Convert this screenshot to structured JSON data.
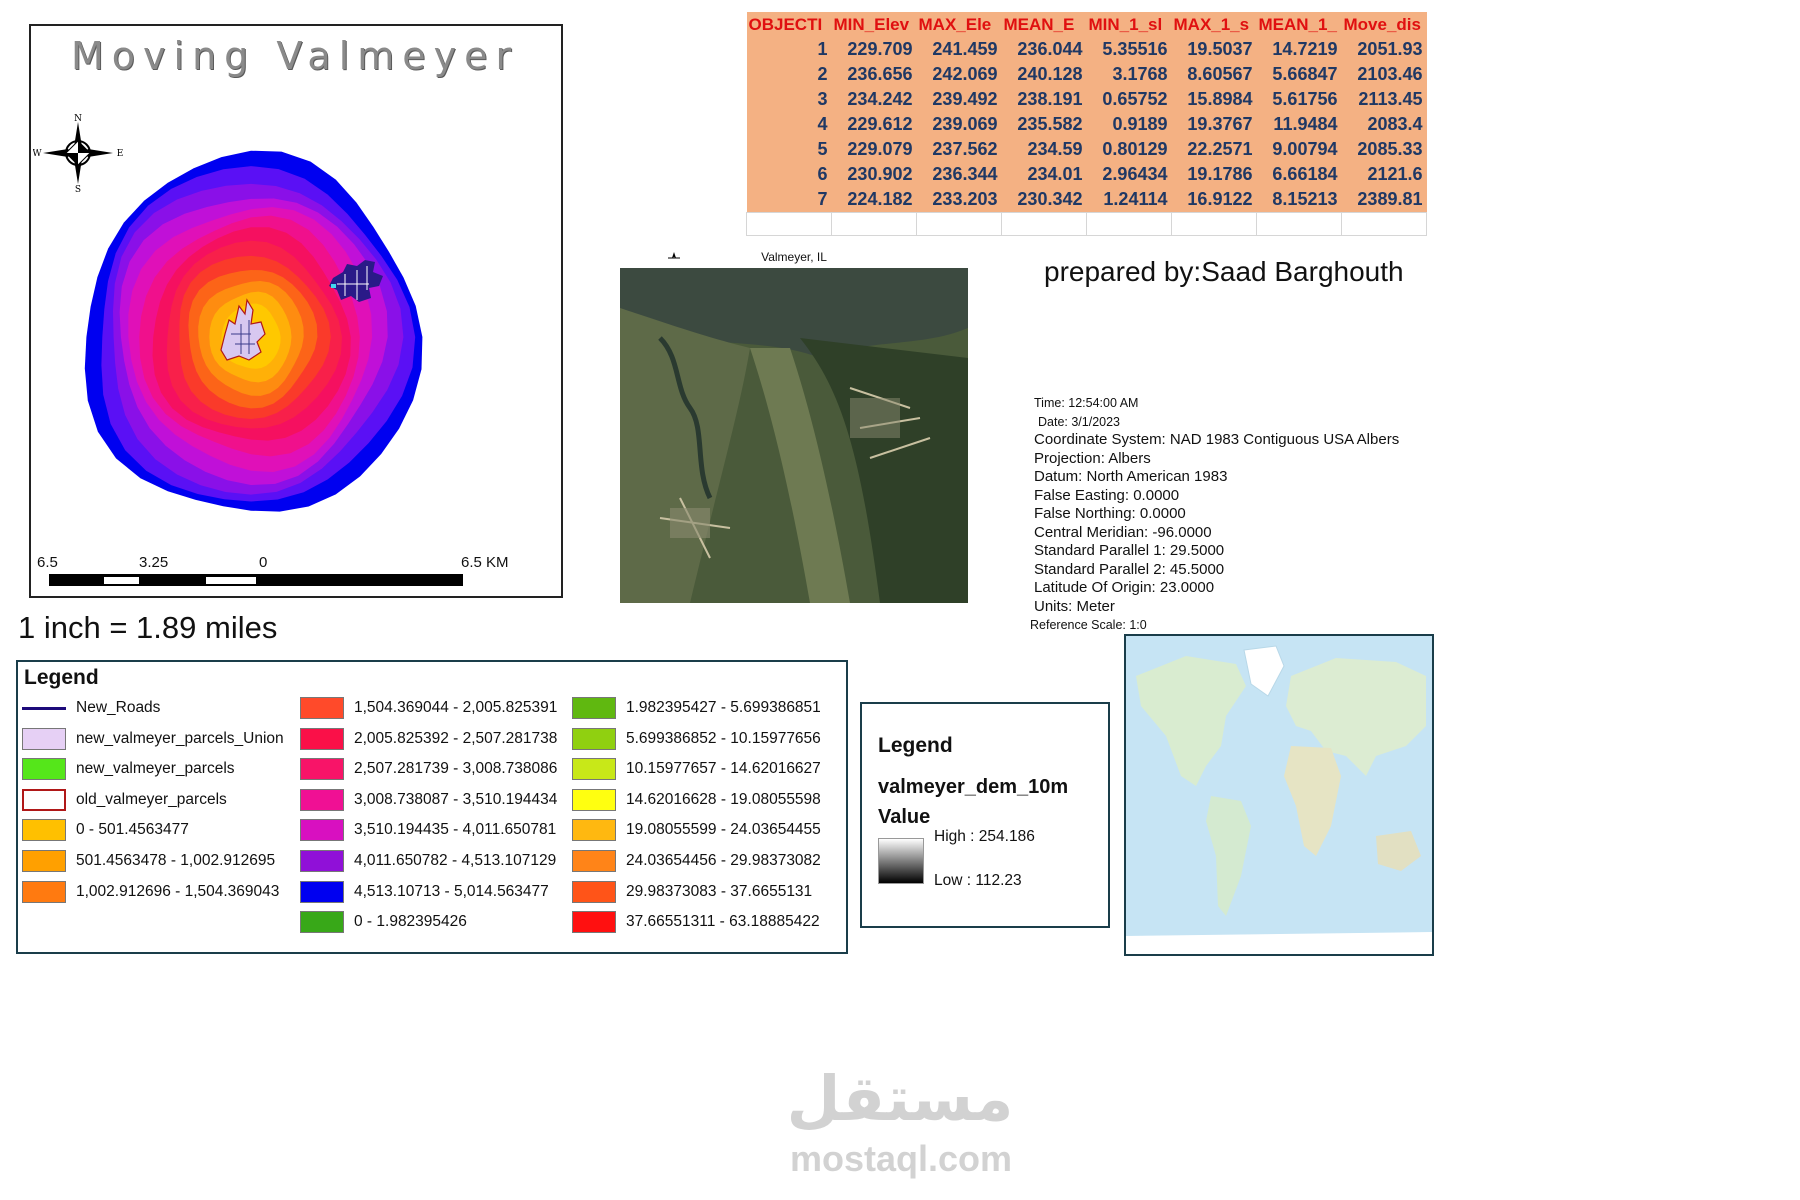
{
  "map": {
    "title": "Moving Valmeyer",
    "north_arrow": {
      "n": "N",
      "e": "E",
      "s": "S",
      "w": "W"
    },
    "scalebar": {
      "labels": [
        "6.5",
        "3.25",
        "0",
        "6.5 KM"
      ]
    },
    "scale_text": "1 inch = 1.89 miles",
    "buffer_ring_colors": [
      "#0000f0",
      "#5a10f5",
      "#8a10e8",
      "#c010d8",
      "#e010b8",
      "#f0108c",
      "#f51060",
      "#f8204a",
      "#fa3a2a",
      "#fc6418",
      "#fe8c10",
      "#ffb008",
      "#ffc800"
    ]
  },
  "attribute_table": {
    "headers": [
      "OBJECTI",
      "MIN_Elev",
      "MAX_Ele",
      "MEAN_E",
      "MIN_1_sl",
      "MAX_1_s",
      "MEAN_1_",
      "Move_dis"
    ],
    "rows": [
      [
        "1",
        "229.709",
        "241.459",
        "236.044",
        "5.35516",
        "19.5037",
        "14.7219",
        "2051.93"
      ],
      [
        "2",
        "236.656",
        "242.069",
        "240.128",
        "3.1768",
        "8.60567",
        "5.66847",
        "2103.46"
      ],
      [
        "3",
        "234.242",
        "239.492",
        "238.191",
        "0.65752",
        "15.8984",
        "5.61756",
        "2113.45"
      ],
      [
        "4",
        "229.612",
        "239.069",
        "235.582",
        "0.9189",
        "19.3767",
        "11.9484",
        "2083.4"
      ],
      [
        "5",
        "229.079",
        "237.562",
        "234.59",
        "0.80129",
        "22.2571",
        "9.00794",
        "2085.33"
      ],
      [
        "6",
        "230.902",
        "236.344",
        "234.01",
        "2.96434",
        "19.1786",
        "6.66184",
        "2121.6"
      ],
      [
        "7",
        "224.182",
        "233.203",
        "230.342",
        "1.24114",
        "16.9122",
        "8.15213",
        "2389.81"
      ]
    ]
  },
  "aerial": {
    "title": "Valmeyer, IL"
  },
  "prepared_by": "prepared by:Saad Barghouth",
  "metadata": {
    "time": "Time: 12:54:00 AM",
    "date": "Date: 3/1/2023",
    "lines": [
      "Coordinate System: NAD 1983 Contiguous USA Albers",
      "Projection: Albers",
      "Datum: North American 1983",
      "False Easting: 0.0000",
      "False Northing: 0.0000",
      "Central Meridian: -96.0000",
      "Standard Parallel 1: 29.5000",
      "Standard Parallel 2: 45.5000",
      "Latitude Of Origin: 23.0000",
      "Units: Meter"
    ],
    "reference_scale": "Reference Scale: 1:0"
  },
  "legend_main": {
    "title": "Legend",
    "col1": [
      {
        "label": "New_Roads",
        "kind": "line",
        "color": "#1d0a7a"
      },
      {
        "label": "new_valmeyer_parcels_Union",
        "kind": "fill",
        "color": "#e6d0f5"
      },
      {
        "label": "new_valmeyer_parcels",
        "kind": "fill",
        "color": "#55e61a"
      },
      {
        "label": "old_valmeyer_parcels",
        "kind": "outline",
        "color": "#b01818"
      },
      {
        "label": "0 - 501.4563477",
        "kind": "fill",
        "color": "#ffc000"
      },
      {
        "label": "501.4563478 - 1,002.912695",
        "kind": "fill",
        "color": "#ffa000"
      },
      {
        "label": "1,002.912696 - 1,504.369043",
        "kind": "fill",
        "color": "#ff7a10"
      }
    ],
    "col2": [
      {
        "label": "1,504.369044 - 2,005.825391",
        "color": "#ff4a2a"
      },
      {
        "label": "2,005.825392 - 2,507.281738",
        "color": "#fa1048"
      },
      {
        "label": "2,507.281739 - 3,008.738086",
        "color": "#f81468"
      },
      {
        "label": "3,008.738087 - 3,510.194434",
        "color": "#f01094"
      },
      {
        "label": "3,510.194435 - 4,011.650781",
        "color": "#d810c0"
      },
      {
        "label": "4,011.650782 - 4,513.107129",
        "color": "#9010d8"
      },
      {
        "label": "4,513.10713 - 5,014.563477",
        "color": "#0000f0"
      },
      {
        "label": "0 - 1.982395426",
        "color": "#38a818"
      }
    ],
    "col3": [
      {
        "label": "1.982395427 - 5.699386851",
        "color": "#60b810"
      },
      {
        "label": "5.699386852 - 10.15977656",
        "color": "#90d010"
      },
      {
        "label": "10.15977657 - 14.62016627",
        "color": "#c8e818"
      },
      {
        "label": "14.62016628 - 19.08055598",
        "color": "#ffff10"
      },
      {
        "label": "19.08055599 - 24.03654455",
        "color": "#ffb810"
      },
      {
        "label": "24.03654456 - 29.98373082",
        "color": "#ff8418"
      },
      {
        "label": "29.98373083 - 37.6655131",
        "color": "#ff5418"
      },
      {
        "label": "37.66551311 - 63.18885422",
        "color": "#ff1010"
      }
    ]
  },
  "legend_dem": {
    "title": "Legend",
    "layer": "valmeyer_dem_10m",
    "value_label": "Value",
    "high": "High : 254.186",
    "low": "Low : 112.23"
  },
  "watermark": {
    "text": "mostaql.com",
    "logo_text": "مستقل"
  }
}
